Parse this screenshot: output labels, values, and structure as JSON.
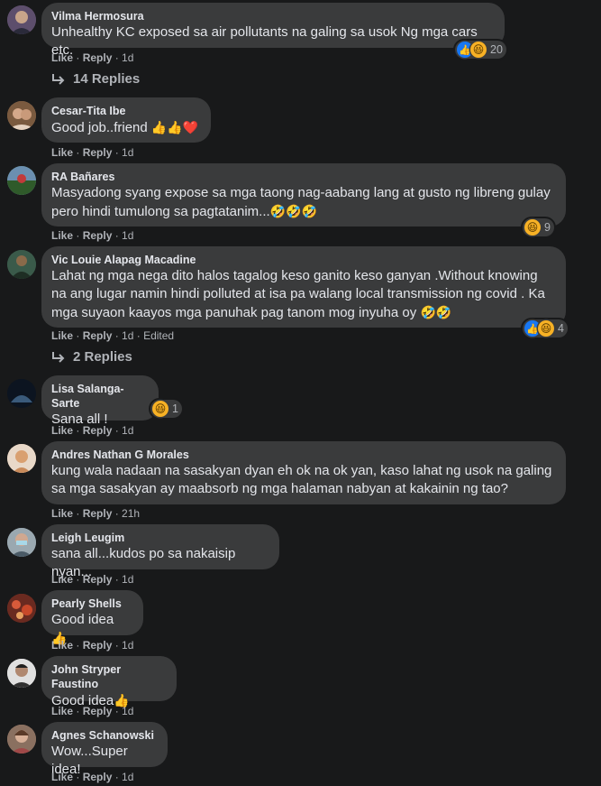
{
  "comments": [
    {
      "author": "Vilma Hermosura",
      "text": "Unhealthy KC exposed sa air pollutants na galing sa usok Ng mga cars etc.",
      "like": "Like",
      "reply": "Reply",
      "time": "1d",
      "reaction_count": "20",
      "reactions": [
        "like",
        "haha"
      ],
      "replies": "14 Replies",
      "avatar_color": "#6b5b7a"
    },
    {
      "author": "Cesar-Tita Ibe",
      "text": "Good job..friend",
      "emoji": "👍👍❤️",
      "like": "Like",
      "reply": "Reply",
      "time": "1d",
      "avatar_color": "#8a6a4f"
    },
    {
      "author": "RA Bañares",
      "text": "Masyadong syang expose sa mga taong nag-aabang lang at gusto ng libreng gulay pero hindi tumulong sa pagtatanim...",
      "emoji": "🤣🤣🤣",
      "like": "Like",
      "reply": "Reply",
      "time": "1d",
      "reaction_count": "9",
      "reactions": [
        "haha"
      ],
      "avatar_color": "#3e6b3a"
    },
    {
      "author": "Vic Louie Alapag Macadine",
      "text": "Lahat ng mga nega dito halos tagalog keso ganito keso ganyan .Without knowing na ang lugar namin hindi polluted at isa pa walang local transmission ng covid . Ka mga suyaon kaayos mga panuhak pag tanom mog inyuha oy",
      "emoji": "🤣🤣",
      "like": "Like",
      "reply": "Reply",
      "time": "1d",
      "edited": "Edited",
      "reaction_count": "4",
      "reactions": [
        "like",
        "haha"
      ],
      "replies": "2 Replies",
      "avatar_color": "#2f4a3a"
    },
    {
      "author": "Lisa Salanga-Sarte",
      "text": "Sana all !",
      "like": "Like",
      "reply": "Reply",
      "time": "1d",
      "reaction_count": "1",
      "reactions": [
        "haha"
      ],
      "avatar_color": "#101820"
    },
    {
      "author": "Andres Nathan G Morales",
      "text": "kung wala nadaan na sasakyan dyan eh ok na ok yan, kaso lahat ng usok na galing sa mga sasakyan ay maabsorb ng mga halaman nabyan at kakainin ng tao?",
      "like": "Like",
      "reply": "Reply",
      "time": "21h",
      "avatar_color": "#c9a27a"
    },
    {
      "author": "Leigh Leugim",
      "text": "sana all...kudos po sa nakaisip nyan...",
      "like": "Like",
      "reply": "Reply",
      "time": "1d",
      "avatar_color": "#7a8a96"
    },
    {
      "author": "Pearly Shells",
      "text": "Good idea",
      "emoji": "👍",
      "like": "Like",
      "reply": "Reply",
      "time": "1d",
      "avatar_color": "#8a3a2a"
    },
    {
      "author": "John Stryper Faustino",
      "text": "Good idea",
      "emoji": "👍",
      "like": "Like",
      "reply": "Reply",
      "time": "1d",
      "avatar_color": "#d8d8d8"
    },
    {
      "author": "Agnes Schanowski",
      "text": "Wow...Super idea!",
      "like": "Like",
      "reply": "Reply",
      "time": "1d",
      "avatar_color": "#9a7a6a"
    }
  ]
}
